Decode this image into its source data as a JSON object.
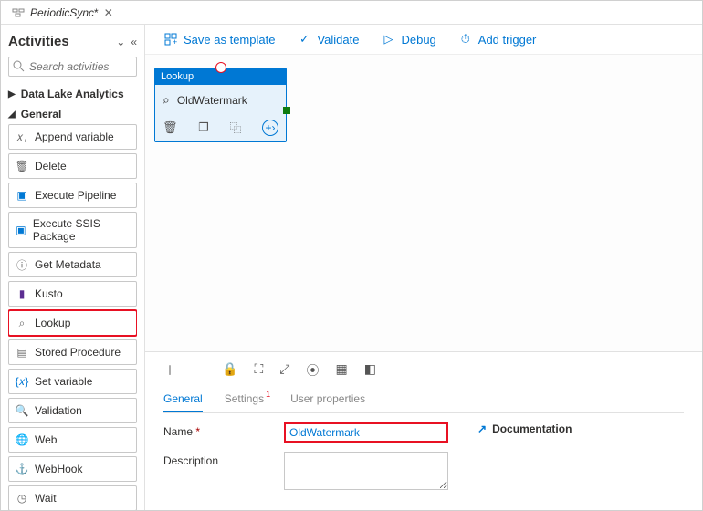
{
  "tab": {
    "title": "PeriodicSync",
    "dirty": "*"
  },
  "sidebar": {
    "title": "Activities",
    "search_placeholder": "Search activities",
    "categories": {
      "dla": "Data Lake Analytics",
      "general": "General"
    },
    "items": [
      {
        "label": "Append variable"
      },
      {
        "label": "Delete"
      },
      {
        "label": "Execute Pipeline"
      },
      {
        "label": "Execute SSIS Package"
      },
      {
        "label": "Get Metadata"
      },
      {
        "label": "Kusto"
      },
      {
        "label": "Lookup"
      },
      {
        "label": "Stored Procedure"
      },
      {
        "label": "Set variable"
      },
      {
        "label": "Validation"
      },
      {
        "label": "Web"
      },
      {
        "label": "WebHook"
      },
      {
        "label": "Wait"
      }
    ]
  },
  "toolbar": {
    "save": "Save as template",
    "validate": "Validate",
    "debug": "Debug",
    "trigger": "Add trigger"
  },
  "node": {
    "type": "Lookup",
    "name": "OldWatermark"
  },
  "bottom": {
    "tabs": {
      "general": "General",
      "settings": "Settings",
      "userprops": "User properties"
    },
    "name_label": "Name",
    "name_value": "OldWatermark",
    "desc_label": "Description",
    "doc_label": "Documentation"
  }
}
